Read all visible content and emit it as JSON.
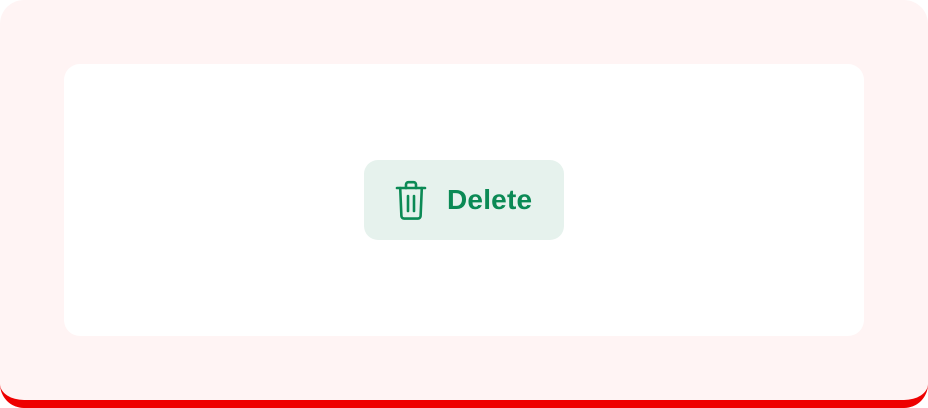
{
  "button": {
    "label": "Delete",
    "icon": "trash-icon"
  },
  "colors": {
    "frame_background": "#fff4f4",
    "frame_bottom_border": "#ee0000",
    "card_background": "#ffffff",
    "button_background": "#e6f2ed",
    "button_foreground": "#0b8a55"
  }
}
